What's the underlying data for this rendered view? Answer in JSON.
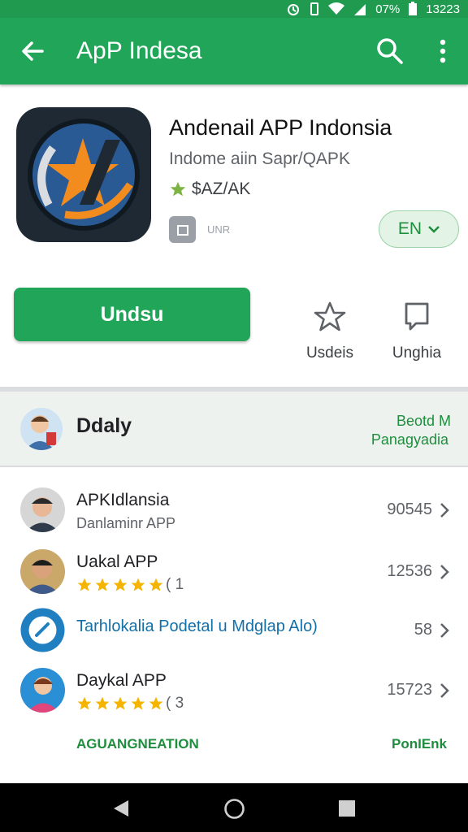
{
  "status_bar": {
    "battery_pct": "07%",
    "time": "13223"
  },
  "app_bar": {
    "title": "ApP Indesa"
  },
  "app": {
    "name": "Andenail APP Indonsia",
    "developer": "Indome aiin Sapr/QAPK",
    "price_label": "$AZ/AK",
    "badge_text": "UNR",
    "language_chip": "EN"
  },
  "actions": {
    "install_label": "Undsu",
    "wishlist_label": "Usdeis",
    "review_label": "Unghia"
  },
  "daily": {
    "label": "Ddaly",
    "link_line1": "Beotd M",
    "link_line2": "Panagyadia"
  },
  "list": [
    {
      "title": "APKIdlansia",
      "subtitle": "Danlaminr APP",
      "count": "90545"
    },
    {
      "title": "Uakal APP",
      "rating_suffix": "( 1",
      "count": "12536",
      "stars": 5
    },
    {
      "title": "Tarhlokalia Podetal u Mdglap Alo)",
      "count": "58"
    },
    {
      "title": "Daykal APP",
      "rating_suffix": "( 3",
      "count": "15723",
      "stars": 5
    }
  ],
  "footer": {
    "left_link": "AGUANGNEATION",
    "right_link": "PonIEnk"
  },
  "colors": {
    "primary": "#21a559",
    "status_bar": "#1f9a4f",
    "link_green": "#1e8e3e",
    "link_blue": "#136fa8",
    "star": "#f4b400"
  },
  "icons": [
    "back-arrow-icon",
    "search-icon",
    "more-vert-icon",
    "star-outline-icon",
    "comment-icon",
    "chevron-right-icon",
    "nav-back-icon",
    "nav-home-icon",
    "nav-recents-icon"
  ]
}
